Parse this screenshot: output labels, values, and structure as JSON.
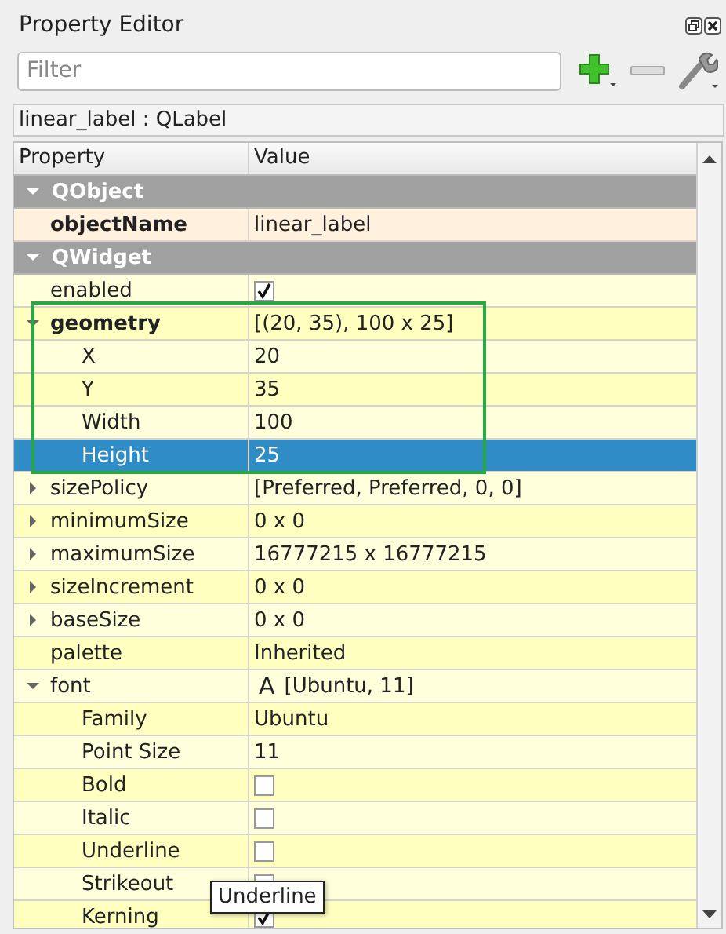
{
  "panel": {
    "title": "Property Editor"
  },
  "filter": {
    "placeholder": "Filter"
  },
  "object_label": "linear_label : QLabel",
  "columns": [
    "Property",
    "Value"
  ],
  "categories": [
    {
      "name": "QObject",
      "expanded": true,
      "color": "#fff1de",
      "properties": [
        {
          "name": "objectName",
          "kind": "text",
          "value": "linear_label",
          "bold": true
        }
      ]
    },
    {
      "name": "QWidget",
      "expanded": true,
      "color": "#ffffdc",
      "properties": [
        {
          "name": "enabled",
          "kind": "checkbox",
          "checked": true,
          "bold": false
        },
        {
          "name": "geometry",
          "kind": "text",
          "value": "[(20, 35), 100 x 25]",
          "bold": true,
          "expanded": true,
          "highlighted": true,
          "children": [
            {
              "name": "X",
              "kind": "text",
              "value": "20",
              "selected": false
            },
            {
              "name": "Y",
              "kind": "text",
              "value": "35",
              "selected": false
            },
            {
              "name": "Width",
              "kind": "text",
              "value": "100",
              "selected": false
            },
            {
              "name": "Height",
              "kind": "text",
              "value": "25",
              "selected": true
            }
          ]
        },
        {
          "name": "sizePolicy",
          "kind": "text",
          "value": "[Preferred, Preferred, 0, 0]",
          "bold": false,
          "expanded": false
        },
        {
          "name": "minimumSize",
          "kind": "text",
          "value": "0 x 0",
          "bold": false,
          "expanded": false
        },
        {
          "name": "maximumSize",
          "kind": "text",
          "value": "16777215 x 16777215",
          "bold": false,
          "expanded": false
        },
        {
          "name": "sizeIncrement",
          "kind": "text",
          "value": "0 x 0",
          "bold": false,
          "expanded": false
        },
        {
          "name": "baseSize",
          "kind": "text",
          "value": "0 x 0",
          "bold": false,
          "expanded": false
        },
        {
          "name": "palette",
          "kind": "text",
          "value": "Inherited",
          "bold": false
        },
        {
          "name": "font",
          "kind": "font",
          "prefix": "A",
          "value": "[Ubuntu, 11]",
          "bold": false,
          "expanded": true,
          "children": [
            {
              "name": "Family",
              "kind": "text",
              "value": "Ubuntu",
              "selected": false
            },
            {
              "name": "Point Size",
              "kind": "text",
              "value": "11",
              "selected": false
            },
            {
              "name": "Bold",
              "kind": "checkbox",
              "checked": false,
              "selected": false
            },
            {
              "name": "Italic",
              "kind": "checkbox",
              "checked": false,
              "selected": false
            },
            {
              "name": "Underline",
              "kind": "checkbox",
              "checked": false,
              "selected": false
            },
            {
              "name": "Strikeout",
              "kind": "checkbox",
              "selected": false
            },
            {
              "name": "Kerning",
              "kind": "checkbox",
              "checked": true,
              "selected": false
            }
          ]
        }
      ]
    }
  ],
  "tooltip": {
    "text": "Underline"
  }
}
